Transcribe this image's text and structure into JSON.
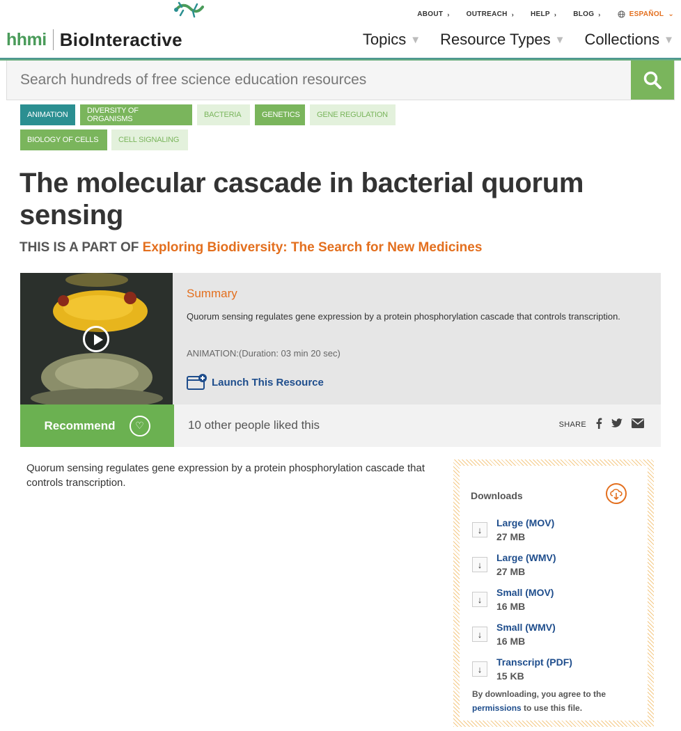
{
  "header": {
    "logo_hhmi": "hhmi",
    "logo_site": "BioInteractive",
    "top_nav": [
      {
        "label": "ABOUT"
      },
      {
        "label": "OUTREACH"
      },
      {
        "label": "HELP"
      },
      {
        "label": "BLOG"
      }
    ],
    "language": "ESPAÑOL",
    "main_nav": [
      {
        "label": "Topics"
      },
      {
        "label": "Resource Types"
      },
      {
        "label": "Collections"
      }
    ]
  },
  "search": {
    "placeholder": "Search hundreds of free science education resources",
    "icon": "search-icon"
  },
  "tags": [
    {
      "label": "ANIMATION",
      "style": "dark"
    },
    {
      "label": "DIVERSITY OF ORGANISMS",
      "style": "green"
    },
    {
      "label": "BACTERIA",
      "style": "light"
    },
    {
      "label": "GENETICS",
      "style": "green"
    },
    {
      "label": "GENE REGULATION",
      "style": "light"
    },
    {
      "label": "BIOLOGY OF CELLS",
      "style": "green"
    },
    {
      "label": "CELL SIGNALING",
      "style": "light"
    }
  ],
  "page": {
    "title": "The molecular cascade in bacterial quorum sensing",
    "part_of_prefix": "THIS IS A PART OF",
    "part_of_link": "Exploring Biodiversity: The Search for New Medicines"
  },
  "feature": {
    "summary_heading": "Summary",
    "summary_text": "Quorum sensing regulates gene expression by a protein phosphorylation cascade that controls transcription.",
    "duration": "ANIMATION:(Duration: 03 min 20 sec)",
    "launch_label": "Launch This Resource"
  },
  "social": {
    "recommend_label": "Recommend",
    "likes_text": "10 other people liked this",
    "share_label": "SHARE"
  },
  "description": "Quorum sensing regulates gene expression by a protein phosphorylation cascade that controls transcription.",
  "downloads": {
    "title": "Downloads",
    "items": [
      {
        "name": "Large (MOV)",
        "size": "27 MB"
      },
      {
        "name": "Large (WMV)",
        "size": "27 MB"
      },
      {
        "name": "Small (MOV)",
        "size": "16 MB"
      },
      {
        "name": "Small (WMV)",
        "size": "16 MB"
      },
      {
        "name": "Transcript (PDF)",
        "size": "15 KB"
      }
    ],
    "note_prefix": "By downloading, you agree to the",
    "note_link": "permissions",
    "note_suffix": "to use this file."
  },
  "colors": {
    "brand_green": "#7ab55c",
    "teal": "#2b8f91",
    "orange": "#e36f1e",
    "link_blue": "#1e4d8c"
  }
}
